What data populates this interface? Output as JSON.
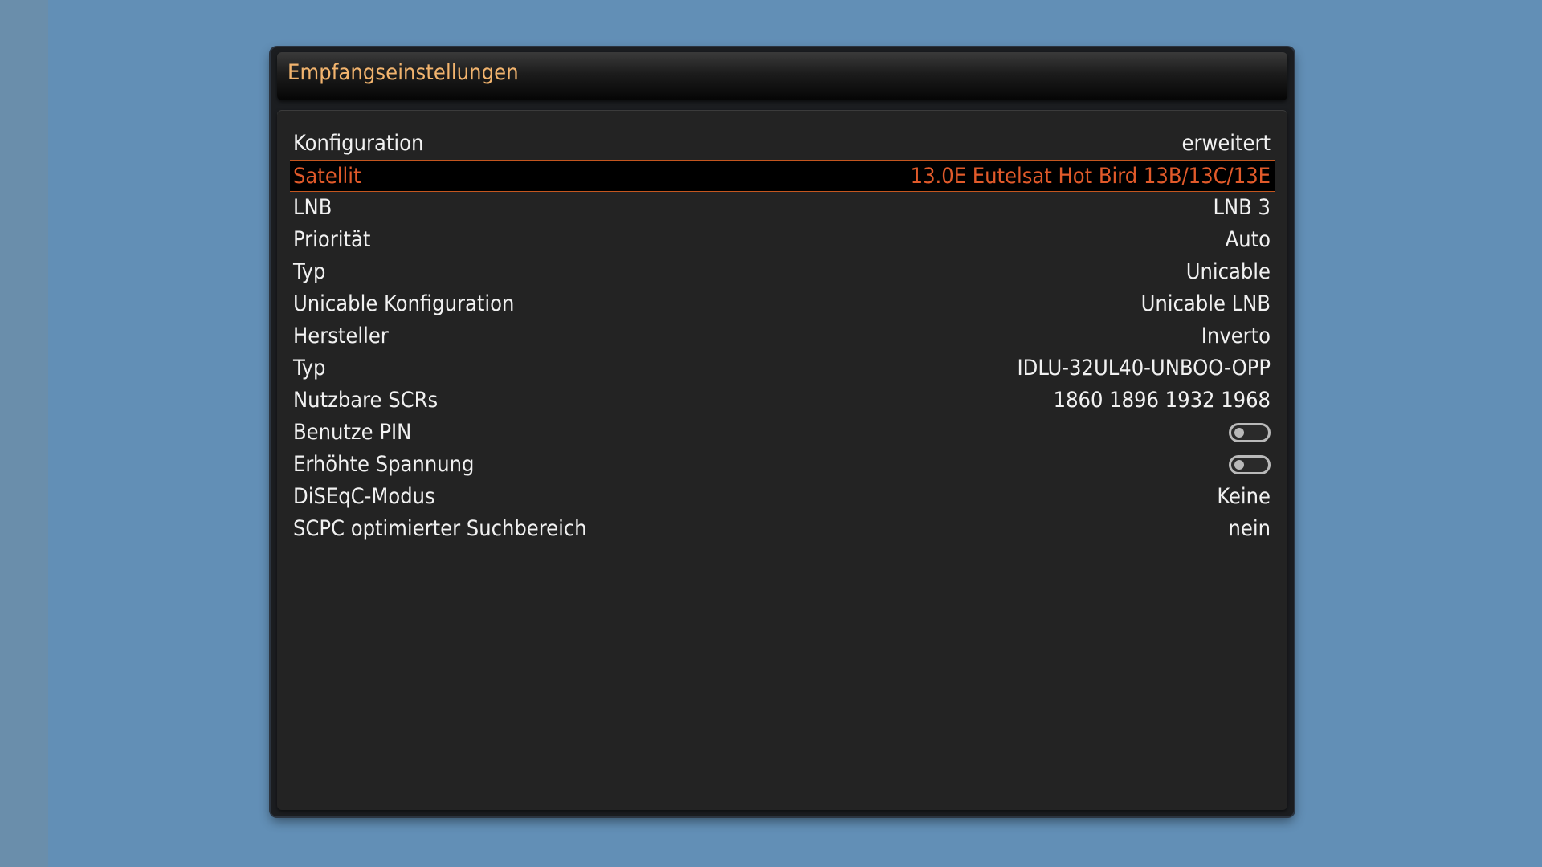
{
  "window": {
    "title": "Empfangseinstellungen"
  },
  "settings": [
    {
      "label": "Konfiguration",
      "value": "erweitert"
    },
    {
      "label": "Satellit",
      "value": "13.0E Eutelsat Hot Bird 13B/13C/13E",
      "selected": true
    },
    {
      "label": "LNB",
      "value": "LNB 3"
    },
    {
      "label": "Priorität",
      "value": "Auto"
    },
    {
      "label": "Typ",
      "value": "Unicable"
    },
    {
      "label": "Unicable Konfiguration",
      "value": "Unicable LNB"
    },
    {
      "label": "Hersteller",
      "value": "Inverto"
    },
    {
      "label": "Typ",
      "value": "IDLU-32UL40-UNBOO-OPP"
    },
    {
      "label": "Nutzbare SCRs",
      "value": "1860 1896 1932 1968"
    },
    {
      "label": "Benutze PIN",
      "toggle": false
    },
    {
      "label": "Erhöhte Spannung",
      "toggle": false
    },
    {
      "label": "DiSEqC-Modus",
      "value": "Keine"
    },
    {
      "label": "SCPC optimierter Suchbereich",
      "value": "nein"
    }
  ],
  "colors": {
    "title": "#f2b46e",
    "selected_text": "#e15a2a",
    "selected_border": "#c4561f",
    "text": "#f1f1f1",
    "background": "#628fb6"
  }
}
